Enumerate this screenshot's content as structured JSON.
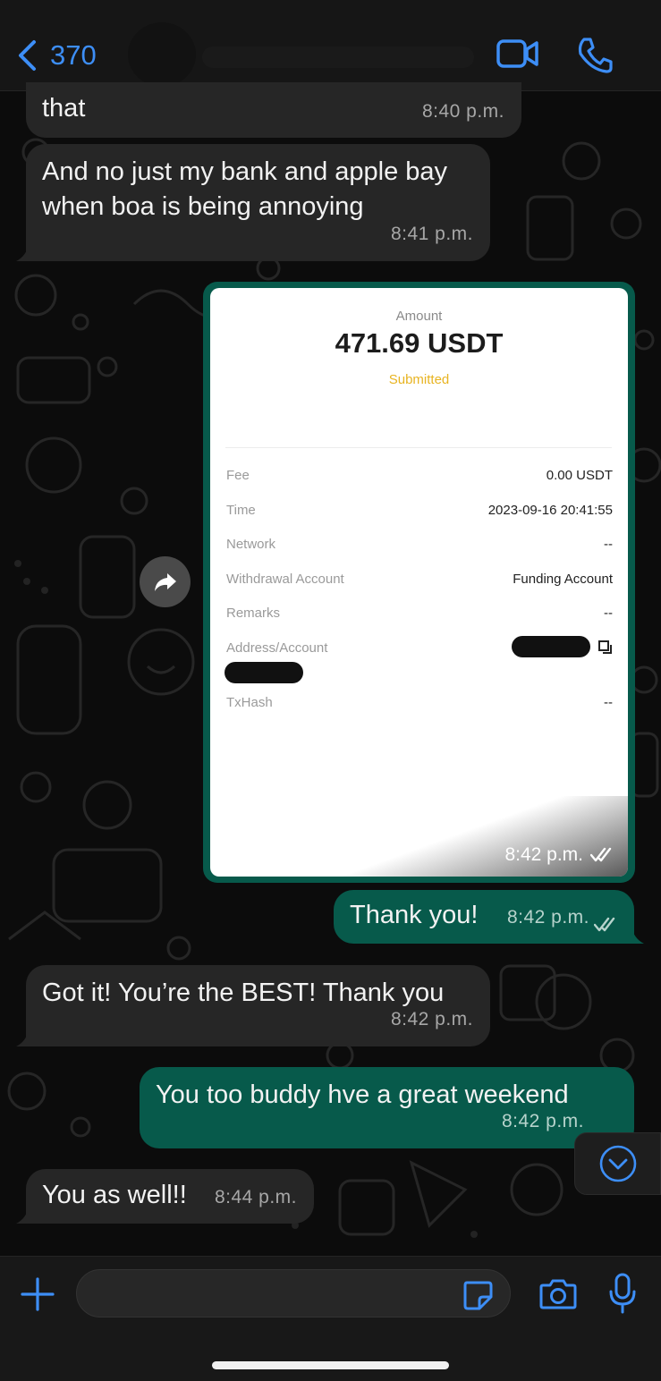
{
  "header": {
    "back_count": "370",
    "video_icon": "video-camera-icon",
    "call_icon": "phone-icon",
    "accent": "#3d8ef6"
  },
  "messages": [
    {
      "dir": "in",
      "text": "that",
      "time": "8:40 p.m."
    },
    {
      "dir": "in",
      "text": "And no just my bank and apple bay when boa is being annoying",
      "time": "8:41 p.m."
    },
    {
      "dir": "out",
      "type": "image",
      "time": "8:42 p.m."
    },
    {
      "dir": "out",
      "text": "Thank you!",
      "time": "8:42 p.m."
    },
    {
      "dir": "in",
      "text": "Got it! You’re the BEST! Thank you",
      "time": "8:42 p.m."
    },
    {
      "dir": "out",
      "text": "You too buddy hve a great weekend",
      "time": "8:42 p.m."
    },
    {
      "dir": "in",
      "text": "You as well!!",
      "time": "8:44 p.m."
    }
  ],
  "receipt": {
    "amount_label": "Amount",
    "amount": "471.69 USDT",
    "status": "Submitted",
    "status_color": "#e8b422",
    "rows": [
      {
        "label": "Fee",
        "value": "0.00 USDT"
      },
      {
        "label": "Time",
        "value": "2023-09-16 20:41:55"
      },
      {
        "label": "Network",
        "value": "--"
      },
      {
        "label": "Withdrawal Account",
        "value": "Funding Account"
      },
      {
        "label": "Remarks",
        "value": "--"
      },
      {
        "label": "Address/Account",
        "value": ""
      },
      {
        "label": "TxHash",
        "value": "--"
      }
    ]
  },
  "composer": {
    "placeholder": "",
    "icons": [
      "plus-icon",
      "sticker-icon",
      "camera-icon",
      "microphone-icon"
    ]
  },
  "colors": {
    "outgoing_bubble": "#075a4b",
    "incoming_bubble": "#262626"
  }
}
